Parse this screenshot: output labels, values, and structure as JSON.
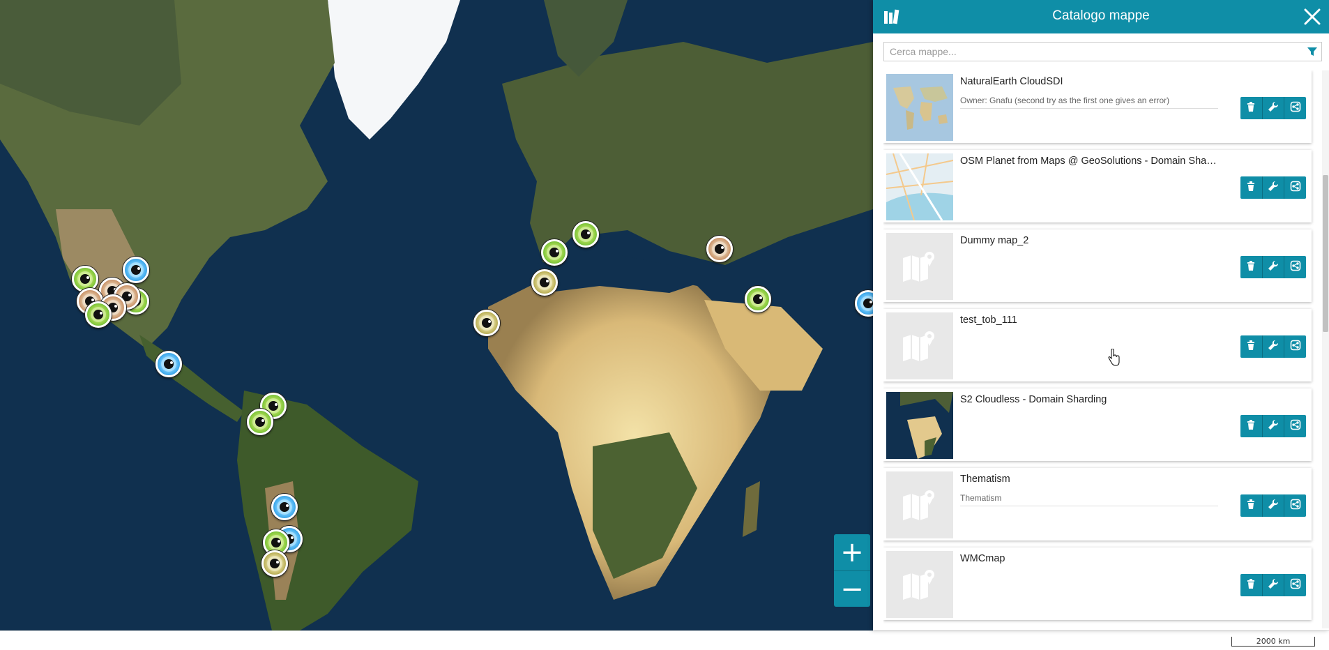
{
  "panel": {
    "title": "Catalogo mappe",
    "search_placeholder": "Cerca mappe..."
  },
  "maps": [
    {
      "title": "NaturalEarth CloudSDI",
      "description": "Owner: Gnafu (second try as the first one gives an error)",
      "thumbnail": "world-map"
    },
    {
      "title": "OSM Planet from Maps @ GeoSolutions - Domain Shardi...",
      "description": "",
      "thumbnail": "osm-street"
    },
    {
      "title": "Dummy map_2",
      "description": "",
      "thumbnail": "placeholder"
    },
    {
      "title": "test_tob_111",
      "description": "",
      "thumbnail": "placeholder"
    },
    {
      "title": "S2 Cloudless - Domain Sharding",
      "description": "",
      "thumbnail": "satellite"
    },
    {
      "title": "Thematism",
      "description": "Thematism",
      "thumbnail": "placeholder"
    },
    {
      "title": "WMCmap",
      "description": "",
      "thumbnail": "placeholder"
    }
  ],
  "card_actions": [
    "delete-icon",
    "wrench-icon",
    "share-icon"
  ],
  "map_view": {
    "zoom_in_label": "+",
    "zoom_out_label": "−",
    "scale_label": "2000 km"
  },
  "colors": {
    "accent": "#0f8ea7",
    "marker_green": "#7bc23a",
    "marker_blue": "#3aa4e8",
    "marker_brown": "#c9936a",
    "marker_olive": "#b8ad55"
  }
}
